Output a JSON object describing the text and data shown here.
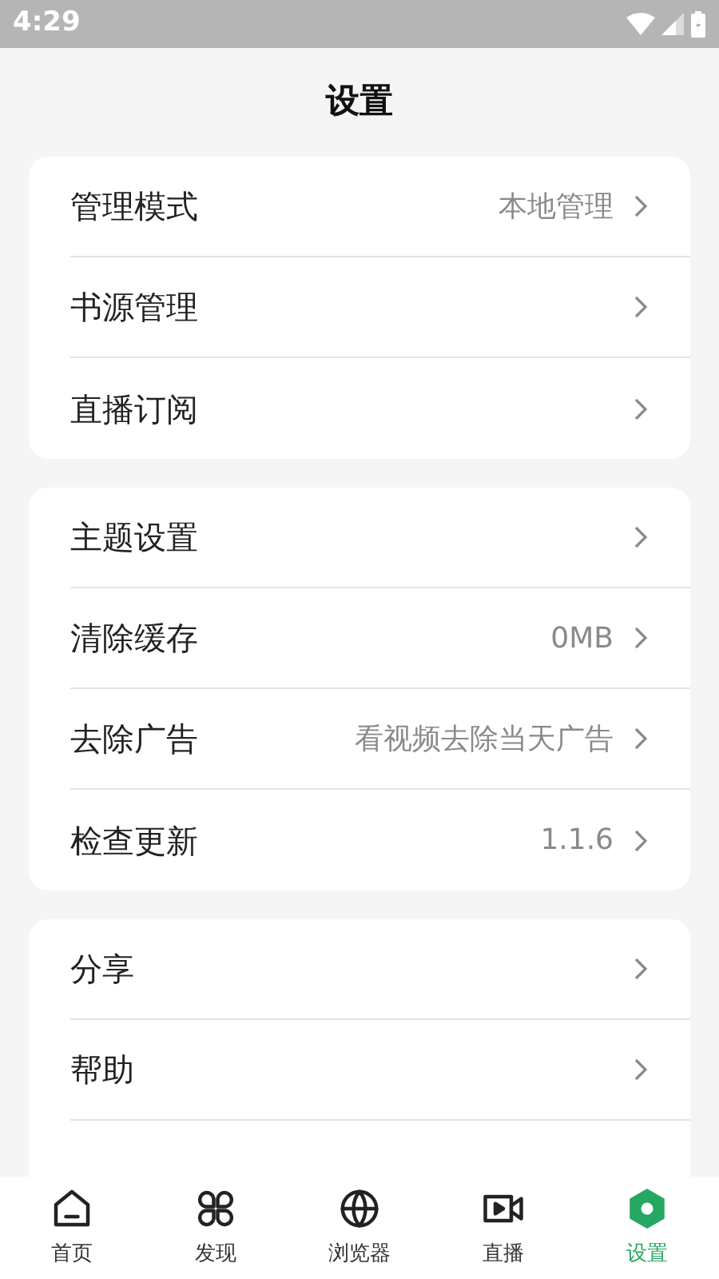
{
  "status_bar": {
    "time": "4:29"
  },
  "title": "设置",
  "groups": [
    {
      "continues": false,
      "rows": [
        {
          "label": "管理模式",
          "value": "本地管理"
        },
        {
          "label": "书源管理"
        },
        {
          "label": "直播订阅"
        }
      ]
    },
    {
      "continues": false,
      "rows": [
        {
          "label": "主题设置"
        },
        {
          "label": "清除缓存",
          "value": "0MB"
        },
        {
          "label": "去除广告",
          "value": "看视频去除当天广告"
        },
        {
          "label": "检查更新",
          "value": "1.1.6"
        }
      ]
    },
    {
      "continues": true,
      "rows": [
        {
          "label": "分享"
        },
        {
          "label": "帮助"
        }
      ]
    }
  ],
  "nav": [
    {
      "kind": "home",
      "label": "首页",
      "selected": false
    },
    {
      "kind": "discover",
      "label": "发现",
      "selected": false
    },
    {
      "kind": "browser",
      "label": "浏览器",
      "selected": false
    },
    {
      "kind": "live",
      "label": "直播",
      "selected": false
    },
    {
      "kind": "settings",
      "label": "设置",
      "selected": true
    }
  ]
}
